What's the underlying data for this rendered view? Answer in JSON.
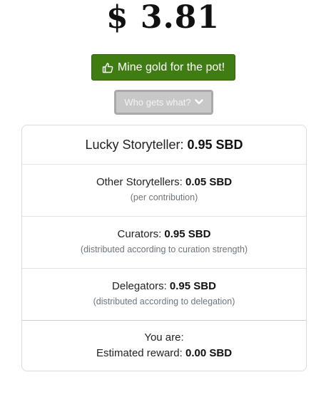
{
  "pot": {
    "amount": "$ 3.81"
  },
  "actions": {
    "mine_label": "Mine gold for the pot!",
    "mine_icon": "thumbs-up-icon",
    "who_label": "Who gets what?",
    "who_icon": "chevron-down-icon"
  },
  "rewards": {
    "lucky": {
      "label": "Lucky Storyteller:",
      "value": "0.95 SBD"
    },
    "other": {
      "label": "Other Storytellers:",
      "value": "0.05 SBD",
      "note": "(per contribution)"
    },
    "curators": {
      "label": "Curators:",
      "value": "0.95 SBD",
      "note": "(distributed according to curation strength)"
    },
    "delegators": {
      "label": "Delegators:",
      "value": "0.95 SBD",
      "note": "(distributed according to delegation)"
    },
    "you": {
      "label": "You are:",
      "estimated_label": "Estimated reward:",
      "estimated_value": "0.00 SBD"
    }
  },
  "colors": {
    "mine_button": "#3f7d12",
    "who_button": "#c8c8c8"
  }
}
